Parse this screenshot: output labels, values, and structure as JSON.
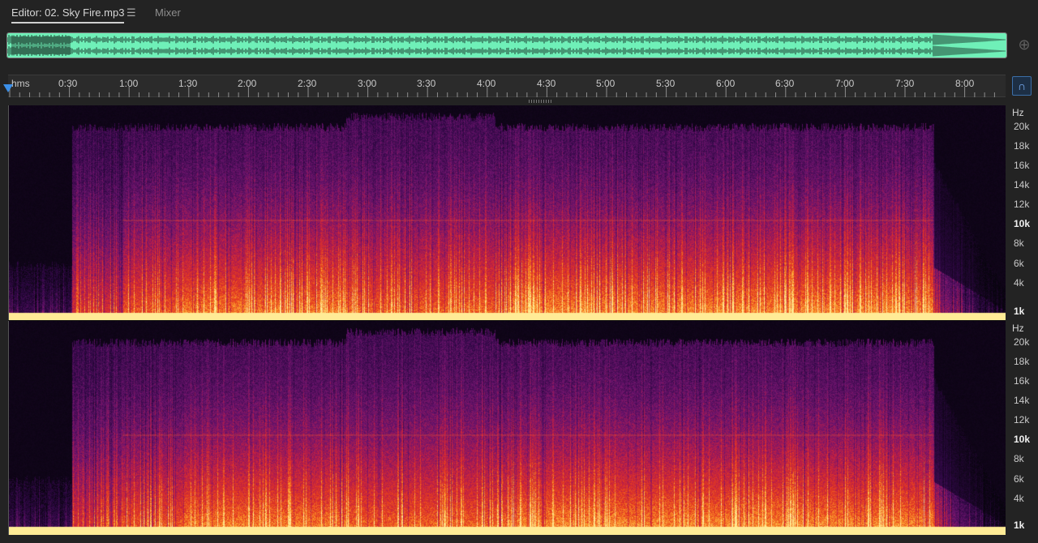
{
  "tabs": {
    "editor_label": "Editor: 02. Sky Fire.mp3",
    "menu_glyph": "☰",
    "mixer_label": "Mixer"
  },
  "overview": {
    "waveform_color": "#6ff0b8",
    "zoom_icon": "zoom-navigator-icon"
  },
  "ruler": {
    "unit_label": "hms",
    "labels": [
      "0:30",
      "1:00",
      "1:30",
      "2:00",
      "2:30",
      "3:00",
      "3:30",
      "4:00",
      "4:30",
      "5:00",
      "5:30",
      "6:00",
      "6:30",
      "7:00",
      "7:30",
      "8:00"
    ],
    "playhead_color": "#3b8fe8",
    "snap_icon": "magnet-icon"
  },
  "spectral": {
    "unit": "Hz",
    "freq_labels": [
      "20k",
      "18k",
      "16k",
      "14k",
      "12k",
      "10k",
      "8k",
      "6k",
      "4k",
      "1k"
    ],
    "bold_labels": [
      "10k",
      "1k"
    ]
  }
}
